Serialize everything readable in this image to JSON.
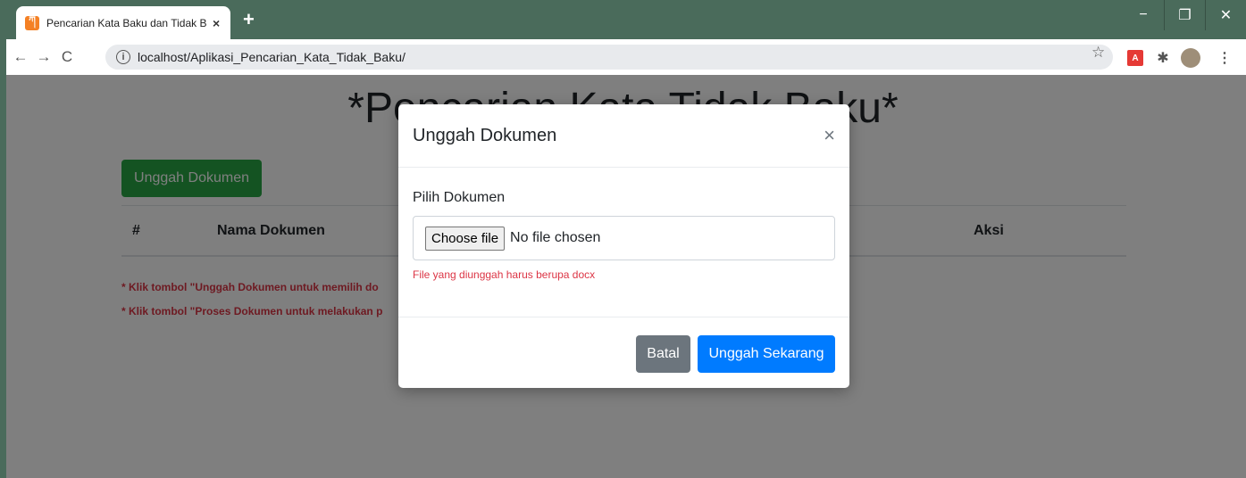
{
  "browser": {
    "tab_title": "Pencarian Kata Baku dan Tidak Baku",
    "favicon": "xampp-icon",
    "close_tab": "×",
    "new_tab": "+",
    "url": "localhost/Aplikasi_Pencarian_Kata_Tidak_Baku/",
    "back": "←",
    "forward": "→",
    "reload": "C",
    "info": "i",
    "star": "☆",
    "ext_label": "A",
    "puzzle": "✱",
    "menu": "⋮",
    "minimize": "−",
    "restore": "❐",
    "close": "✕"
  },
  "page": {
    "title": "*Pencarian Kata Tidak Baku*",
    "upload_button": "Unggah Dokumen",
    "table": {
      "headers": [
        "#",
        "Nama Dokumen",
        "Aksi"
      ]
    },
    "notes": [
      "* Klik tombol \"Unggah Dokumen untuk memilih do",
      "* Klik tombol \"Proses Dokumen untuk melakukan p"
    ]
  },
  "modal": {
    "title": "Unggah Dokumen",
    "close": "×",
    "field_label": "Pilih Dokumen",
    "choose_file": "Choose file",
    "no_file": "No file chosen",
    "help_text": "File yang diunggah harus berupa docx",
    "cancel_button": "Batal",
    "submit_button": "Unggah Sekarang"
  },
  "colors": {
    "success": "#28a745",
    "primary": "#007bff",
    "secondary": "#6c757d",
    "danger": "#dc3545"
  }
}
